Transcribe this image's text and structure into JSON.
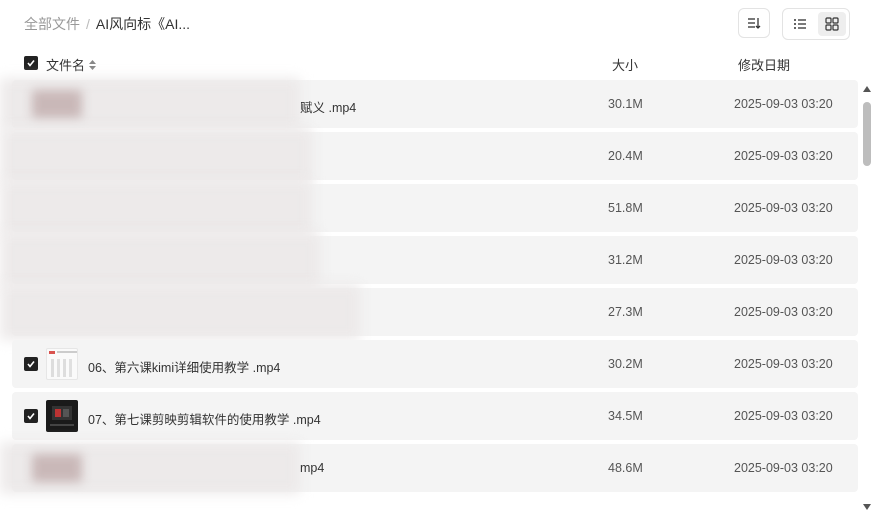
{
  "breadcrumb": {
    "root": "全部文件",
    "separator": "/",
    "current": "AI风向标《AI..."
  },
  "columns": {
    "name": "文件名",
    "size": "大小",
    "date": "修改日期"
  },
  "rows": [
    {
      "name": "赋义 .mp4",
      "size": "30.1M",
      "date": "2025-09-03 03:20",
      "blurred": true
    },
    {
      "name": "",
      "size": "20.4M",
      "date": "2025-09-03 03:20",
      "blurred": true
    },
    {
      "name": "",
      "size": "51.8M",
      "date": "2025-09-03 03:20",
      "blurred": true
    },
    {
      "name": "",
      "size": "31.2M",
      "date": "2025-09-03 03:20",
      "blurred": true
    },
    {
      "name": "",
      "size": "27.3M",
      "date": "2025-09-03 03:20",
      "blurred": true
    },
    {
      "name": "06、第六课kimi详细使用教学 .mp4",
      "size": "30.2M",
      "date": "2025-09-03 03:20",
      "blurred": false
    },
    {
      "name": "07、第七课剪映剪辑软件的使用教学 .mp4",
      "size": "34.5M",
      "date": "2025-09-03 03:20",
      "blurred": false
    },
    {
      "name": "mp4",
      "size": "48.6M",
      "date": "2025-09-03 03:20",
      "blurred": true
    }
  ],
  "icons": {
    "sort": "sort-icon",
    "list_view": "list-view-icon",
    "grid_view": "grid-view-icon",
    "checkbox": "checkbox-checked-icon",
    "sort_toggle": "sort-arrows-icon"
  }
}
